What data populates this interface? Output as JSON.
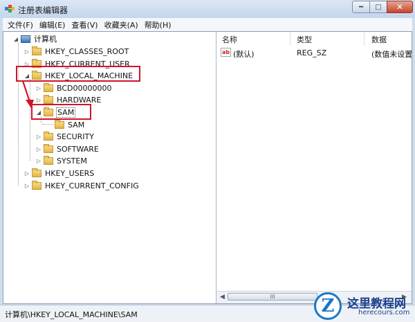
{
  "window": {
    "title": "注册表编辑器"
  },
  "menu": [
    "文件(F)",
    "编辑(E)",
    "查看(V)",
    "收藏夹(A)",
    "帮助(H)"
  ],
  "tree": {
    "root": "计算机",
    "hkcr": "HKEY_CLASSES_ROOT",
    "hkcu": "HKEY_CURRENT_USER",
    "hklm": "HKEY_LOCAL_MACHINE",
    "hklm_children": {
      "bcd": "BCD00000000",
      "hardware": "HARDWARE",
      "sam": "SAM",
      "sam_child": "SAM",
      "security": "SECURITY",
      "software": "SOFTWARE",
      "system": "SYSTEM"
    },
    "hku": "HKEY_USERS",
    "hkcc": "HKEY_CURRENT_CONFIG"
  },
  "list": {
    "columns": {
      "name": "名称",
      "type": "类型",
      "data": "数据"
    },
    "rows": [
      {
        "icon": "ab",
        "name": "(默认)",
        "type": "REG_SZ",
        "data": "(数值未设置"
      }
    ]
  },
  "status": {
    "path": "计算机\\HKEY_LOCAL_MACHINE\\SAM"
  },
  "watermark": {
    "icon": "Z",
    "title": "这里教程网",
    "url": "herecours.com"
  },
  "colors": {
    "highlight": "#d0142a",
    "titlebar": "#c4d6ec"
  },
  "scrollbar": {
    "thumb_grip": "III"
  }
}
